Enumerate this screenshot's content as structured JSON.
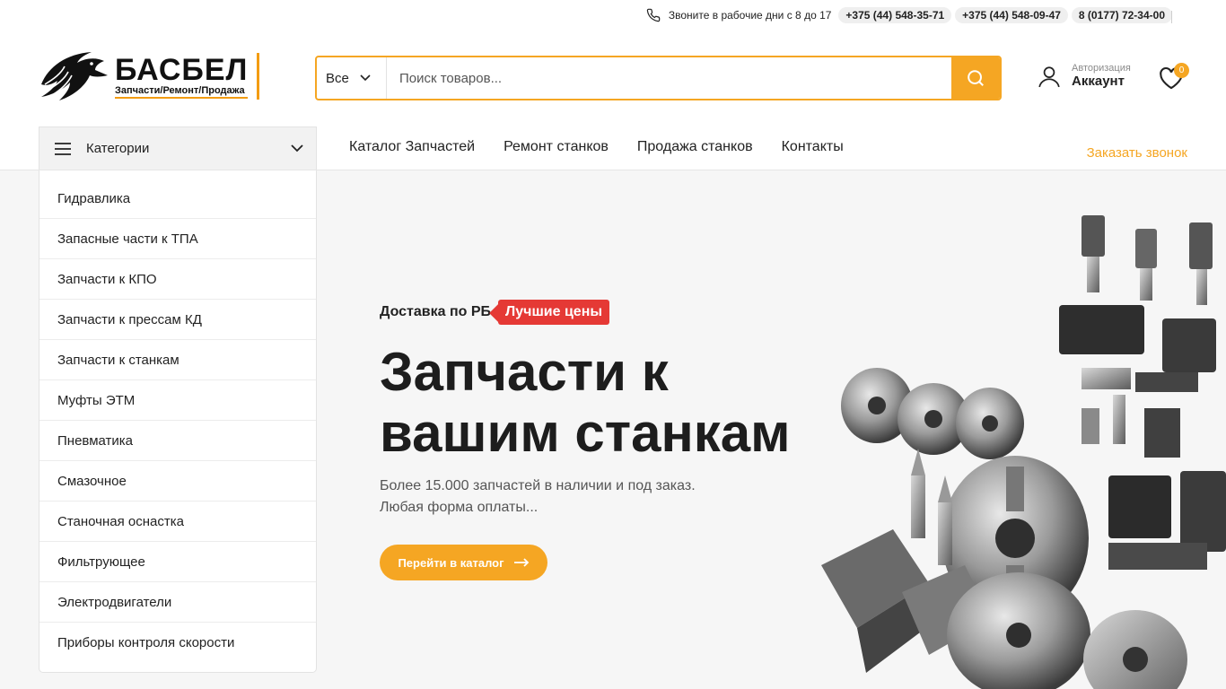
{
  "topbar": {
    "call_text": "Звоните в рабочие дни с 8 до 17",
    "phones": [
      "+375 (44) 548-35-71",
      "+375 (44) 548-09-47",
      "8 (0177) 72-34-00"
    ]
  },
  "logo": {
    "name": "БАСБЕЛ",
    "subtitle": "Запчасти/Ремонт/Продажа"
  },
  "search": {
    "category": "Все",
    "placeholder": "Поиск товаров..."
  },
  "account": {
    "small_label": "Авторизация",
    "label": "Аккаунт"
  },
  "wishlist": {
    "count": "0"
  },
  "nav": {
    "categories_label": "Категории",
    "menu": [
      "Каталог Запчастей",
      "Ремонт станков",
      "Продажа станков",
      "Контакты"
    ],
    "callback": "Заказать звонок"
  },
  "categories": [
    "Гидравлика",
    "Запасные части к ТПА",
    "Запчасти к КПО",
    "Запчасти к прессам КД",
    "Запчасти к станкам",
    "Муфты ЭТМ",
    "Пневматика",
    "Смазочное",
    "Станочная оснастка",
    "Фильтрующее",
    "Электродвигатели",
    "Приборы контроля скорости"
  ],
  "hero": {
    "tag": "Доставка по РБ",
    "badge": "Лучшие цены",
    "title": "Запчасти к вашим станкам",
    "desc_line1": "Более 15.000 запчастей в наличии и под заказ.",
    "desc_line2": "Любая форма оплаты...",
    "cta": "Перейти в каталог"
  },
  "colors": {
    "accent": "#f5a623",
    "badge_red": "#e53935",
    "hero_bg": "#f6f6f6"
  }
}
